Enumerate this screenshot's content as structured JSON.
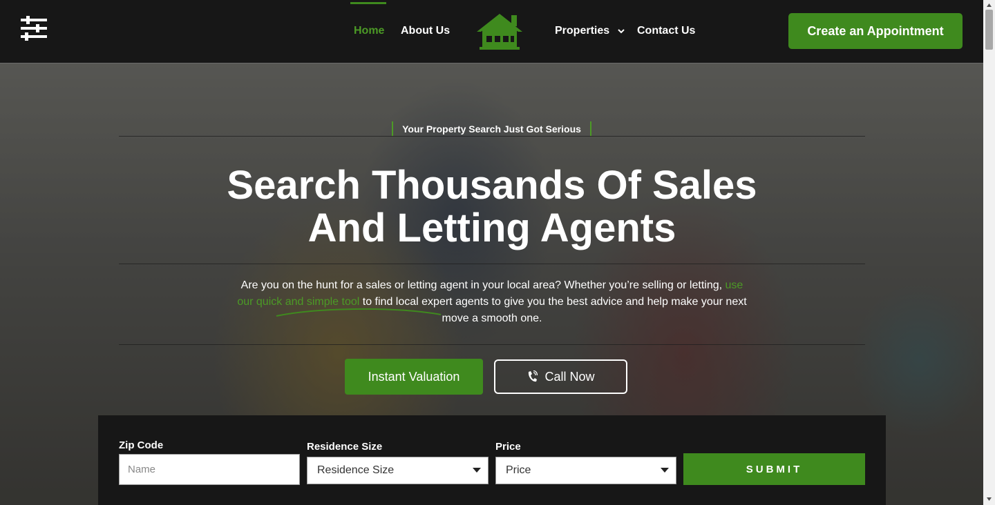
{
  "header": {
    "nav": {
      "home": "Home",
      "about": "About Us",
      "properties": "Properties",
      "contact": "Contact Us"
    },
    "cta_label": "Create an Appointment"
  },
  "hero": {
    "eyebrow": "Your Property Search Just Got Serious",
    "title_line1": "Search Thousands Of Sales",
    "title_line2": "And Letting Agents",
    "desc_part1": "Are you on the hunt for a sales or letting agent in your local area? Whether you’re selling or letting,",
    "desc_link": "use our quick and simple tool",
    "desc_part2": "to find local expert agents to give you the best advice and help make your next move a smooth one.",
    "primary_button": "Instant Valuation",
    "secondary_button": "Call Now"
  },
  "search": {
    "zip_label": "Zip Code",
    "zip_placeholder": "Name",
    "size_label": "Residence Size",
    "size_selected": "Residence Size",
    "price_label": "Price",
    "price_selected": "Price",
    "submit_label": "SUBMIT"
  },
  "colors": {
    "accent": "#3f8a1e",
    "header_bg": "#171717"
  },
  "icons": {
    "menu": "sliders-icon",
    "logo": "house-logo-icon",
    "dropdown": "chevron-down-icon",
    "phone": "phone-icon"
  }
}
